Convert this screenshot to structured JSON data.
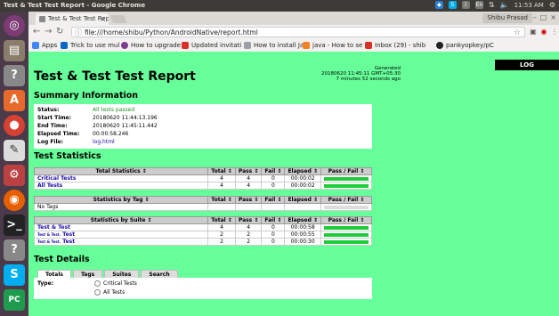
{
  "window": {
    "title": "Test & Test Test Report - Google Chrome"
  },
  "system_tray": {
    "user": "Shibu Prasad",
    "time": "11:53 AM",
    "lang": "En"
  },
  "launcher": {
    "apps": [
      "ubuntu-dash",
      "files",
      "help",
      "software-center",
      "chrome",
      "text-editor",
      "settings",
      "firefox",
      "terminal",
      "help2",
      "skype",
      "pycharm"
    ]
  },
  "browser": {
    "tab_title": "Test & Test Test Rep",
    "profile": "Shibu Prasad",
    "url": "file:///home/shibu/Python/AndroidNative/report.html",
    "bookmarks": [
      "Apps",
      "Trick to use mul",
      "How to upgrade",
      "Updated invitati",
      "How to install Ja",
      "java - How to se",
      "Inbox (29) - shib",
      "pankyopkey/pC"
    ]
  },
  "report": {
    "log_button": "LOG",
    "title": "Test & Test Test Report",
    "generated_label": "Generated",
    "generated_time": "20180620 11:45:11 GMT+05:30",
    "generated_ago": "7 minutes 52 seconds ago",
    "summary_heading": "Summary Information",
    "summary": {
      "status_label": "Status:",
      "status_value": "All tests passed",
      "start_label": "Start Time:",
      "start_value": "20180620 11:44:13.196",
      "end_label": "End Time:",
      "end_value": "20180620 11:45:11.442",
      "elapsed_label": "Elapsed Time:",
      "elapsed_value": "00:00:58.246",
      "log_label": "Log File:",
      "log_value": "log.html"
    },
    "stats_heading": "Test Statistics",
    "col_total": "Total",
    "col_pass": "Pass",
    "col_fail": "Fail",
    "col_elapsed": "Elapsed",
    "col_passfail": "Pass / Fail",
    "total_stats_header": "Total Statistics",
    "total_rows": [
      {
        "name": "Critical Tests",
        "total": "4",
        "pass": "4",
        "fail": "0",
        "elapsed": "00:00:02",
        "ratio": 1
      },
      {
        "name": "All Tests",
        "total": "4",
        "pass": "4",
        "fail": "0",
        "elapsed": "00:00:02",
        "ratio": 1
      }
    ],
    "tag_header": "Statistics by Tag",
    "tag_rows": [
      {
        "name": "No Tags"
      }
    ],
    "suite_header": "Statistics by Suite",
    "suite_rows": [
      {
        "prefix": "",
        "name": "Test & Test",
        "total": "4",
        "pass": "4",
        "fail": "0",
        "elapsed": "00:00:58",
        "ratio": 1
      },
      {
        "prefix": "Test & Test.",
        "name": "Test",
        "total": "2",
        "pass": "2",
        "fail": "0",
        "elapsed": "00:00:55",
        "ratio": 1
      },
      {
        "prefix": "Test & Test.",
        "name": "Test",
        "total": "2",
        "pass": "2",
        "fail": "0",
        "elapsed": "00:00:30",
        "ratio": 1
      }
    ],
    "details_heading": "Test Details",
    "detail_tabs": [
      "Totals",
      "Tags",
      "Suites",
      "Search"
    ],
    "type_label": "Type:",
    "type_options": [
      "Critical Tests",
      "All Tests"
    ]
  }
}
